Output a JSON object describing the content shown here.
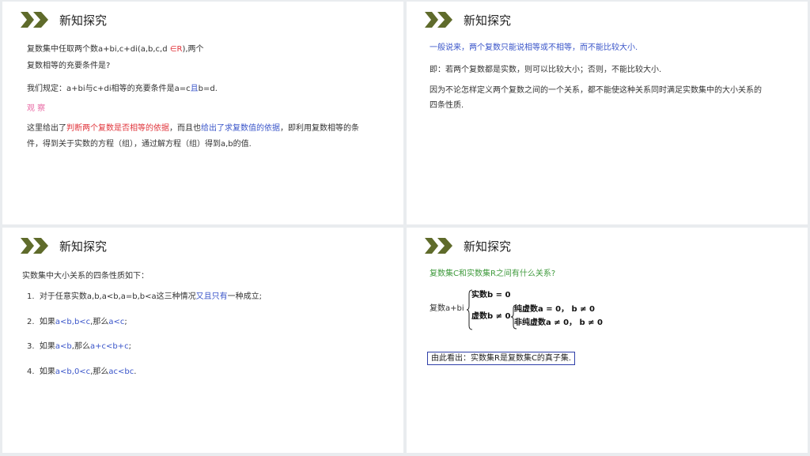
{
  "panel1": {
    "title": "新知探究",
    "q_line1_a": "复数集中任取两个数a+bi,c+di(a,b,c,d ",
    "q_line1_red": "∈R",
    "q_line1_b": "),两个",
    "q_line2": "复数相等的充要条件是?",
    "rule_a": "我们规定：a+bi与c+di相等的充要条件是a=c",
    "rule_blue": "且",
    "rule_b": "b=d.",
    "observe": "观 察",
    "obs1_a": "这里给出了",
    "obs1_red": "判断两个复数是否相等的依据",
    "obs1_b": "，而且也",
    "obs1_blue": "给出了求复数值的依据",
    "obs1_c": "，即利用复数相等的条",
    "obs2": "件，得到关于实数的方程（组），通过解方程（组）得到a,b的值."
  },
  "panel2": {
    "title": "新知探究",
    "line1": "一般说来，两个复数只能说相等或不相等，而不能比较大小.",
    "line2": "即：若两个复数都是实数，则可以比较大小；否则，不能比较大小.",
    "line3": "因为不论怎样定义两个复数之间的一个关系，都不能使这种关系同时满足实数集中的大小关系的",
    "line4": "四条性质."
  },
  "panel3": {
    "title": "新知探究",
    "intro": "实数集中大小关系的四条性质如下：",
    "items": [
      {
        "num": "1.",
        "a": "对于任意实数a,b,a<b,a=b,b<a这三种情况",
        "blue": "又且只有",
        "b": "一种成立;"
      },
      {
        "num": "2.",
        "a": "如果",
        "blue": "a<b,b<c",
        "b": ",那么",
        "blue2": "a<c",
        "c": ";"
      },
      {
        "num": "3.",
        "a": "如果",
        "blue": "a<b",
        "b": ",那么",
        "blue2": "a+c<b+c",
        "c": ";"
      },
      {
        "num": "4.",
        "a": "如果",
        "blue": "a<b,0<c",
        "b": ",那么",
        "blue2": "ac<bc",
        "c": "."
      }
    ]
  },
  "panel4": {
    "title": "新知探究",
    "question": "复数集C和实数集R之间有什么关系?",
    "root": "复数a+bi",
    "real": "实数b = 0",
    "imag": "虚数b ≠ 0",
    "pure": "纯虚数a = 0，  b ≠ 0",
    "nonpure": "非纯虚数a ≠ 0，  b ≠ 0",
    "conclusion": "由此看出：实数集R是复数集C的真子集."
  },
  "colors": {
    "chevron": "#5f6b2b",
    "red": "#e0343b",
    "blue": "#3a55c9",
    "green": "#3f9a3c",
    "box": "#2f3fa8"
  }
}
